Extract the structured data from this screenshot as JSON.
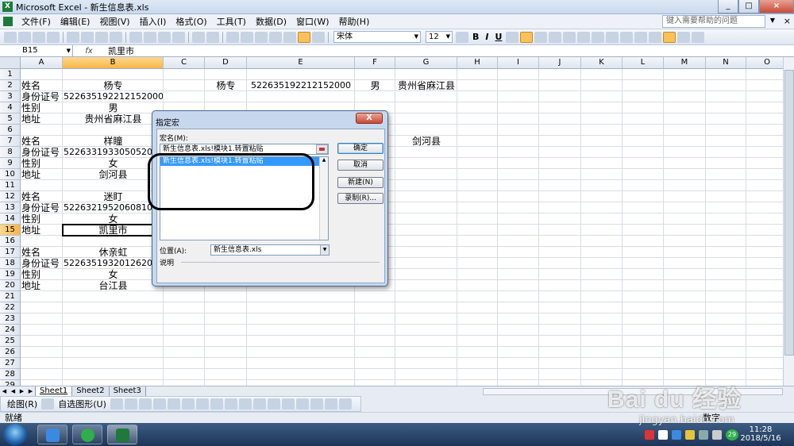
{
  "window": {
    "title": "Microsoft Excel - 新生信息表.xls",
    "app_icon": "excel-icon"
  },
  "menu": {
    "items": [
      "文件(F)",
      "编辑(E)",
      "视图(V)",
      "插入(I)",
      "格式(O)",
      "工具(T)",
      "数据(D)",
      "窗口(W)",
      "帮助(H)"
    ],
    "help_placeholder": "键入需要帮助的问题"
  },
  "toolbar": {
    "font": "宋体",
    "size": "12",
    "bold": "B",
    "italic": "I",
    "underline": "U"
  },
  "formula_bar": {
    "name_box": "B15",
    "fx": "fx",
    "value": "凯里市"
  },
  "columns": [
    "A",
    "B",
    "C",
    "D",
    "E",
    "F",
    "G",
    "H",
    "I",
    "J",
    "K",
    "L",
    "M",
    "N",
    "O"
  ],
  "rows": [
    "1",
    "2",
    "3",
    "4",
    "5",
    "6",
    "7",
    "8",
    "9",
    "10",
    "11",
    "12",
    "13",
    "14",
    "15",
    "16",
    "17",
    "18",
    "19",
    "20",
    "21",
    "22",
    "23",
    "24",
    "25",
    "26",
    "27",
    "28",
    "29"
  ],
  "cells": {
    "A2": "姓名",
    "B2": "杨专",
    "D2": "杨专",
    "E2": "522635192212152000",
    "F2": "男",
    "G2": "贵州省麻江县",
    "A3": "身份证号",
    "B3": "522635192212152000",
    "A4": "性别",
    "B4": "男",
    "A5": "地址",
    "B5": "贵州省麻江县",
    "A7": "姓名",
    "B7": "样瞳",
    "G7": "剑河县",
    "A8": "身份证号",
    "B8": "522633193305052000",
    "A9": "性别",
    "B9": "女",
    "A10": "地址",
    "B10": "剑河县",
    "A12": "姓名",
    "B12": "迷盯",
    "A13": "身份证号",
    "B13": "522632195206081000",
    "A14": "性别",
    "B14": "女",
    "A15": "地址",
    "B15": "凯里市",
    "A17": "姓名",
    "B17": "休亲虹",
    "A18": "身份证号",
    "B18": "522635193201262000",
    "A19": "性别",
    "B19": "女",
    "A20": "地址",
    "B20": "台江县"
  },
  "sheets": [
    "Sheet1",
    "Sheet2",
    "Sheet3"
  ],
  "drawing": {
    "draw_label": "绘图(R)",
    "autoshapes_label": "自选图形(U)"
  },
  "status": {
    "mode": "就绪",
    "indicator": "数字"
  },
  "clock": {
    "time": "11:28",
    "date": "2018/5/16"
  },
  "tray_badge": "29",
  "dialog": {
    "title": "指定宏",
    "close": "X",
    "macro_name_label": "宏名(M):",
    "macro_name_value": "新生信息表.xls!模块1.转置粘贴",
    "macro_list": [
      "新生信息表.xls!模块1.转置粘贴"
    ],
    "buttons": {
      "ok": "确定",
      "cancel": "取消",
      "new": "新建(N)",
      "record": "录制(R)..."
    },
    "location_label": "位置(A):",
    "location_value": "新生信息表.xls",
    "description_label": "说明"
  },
  "watermark": {
    "logo": "Bai du 经验",
    "sub": "jingyan.baidu.com"
  }
}
